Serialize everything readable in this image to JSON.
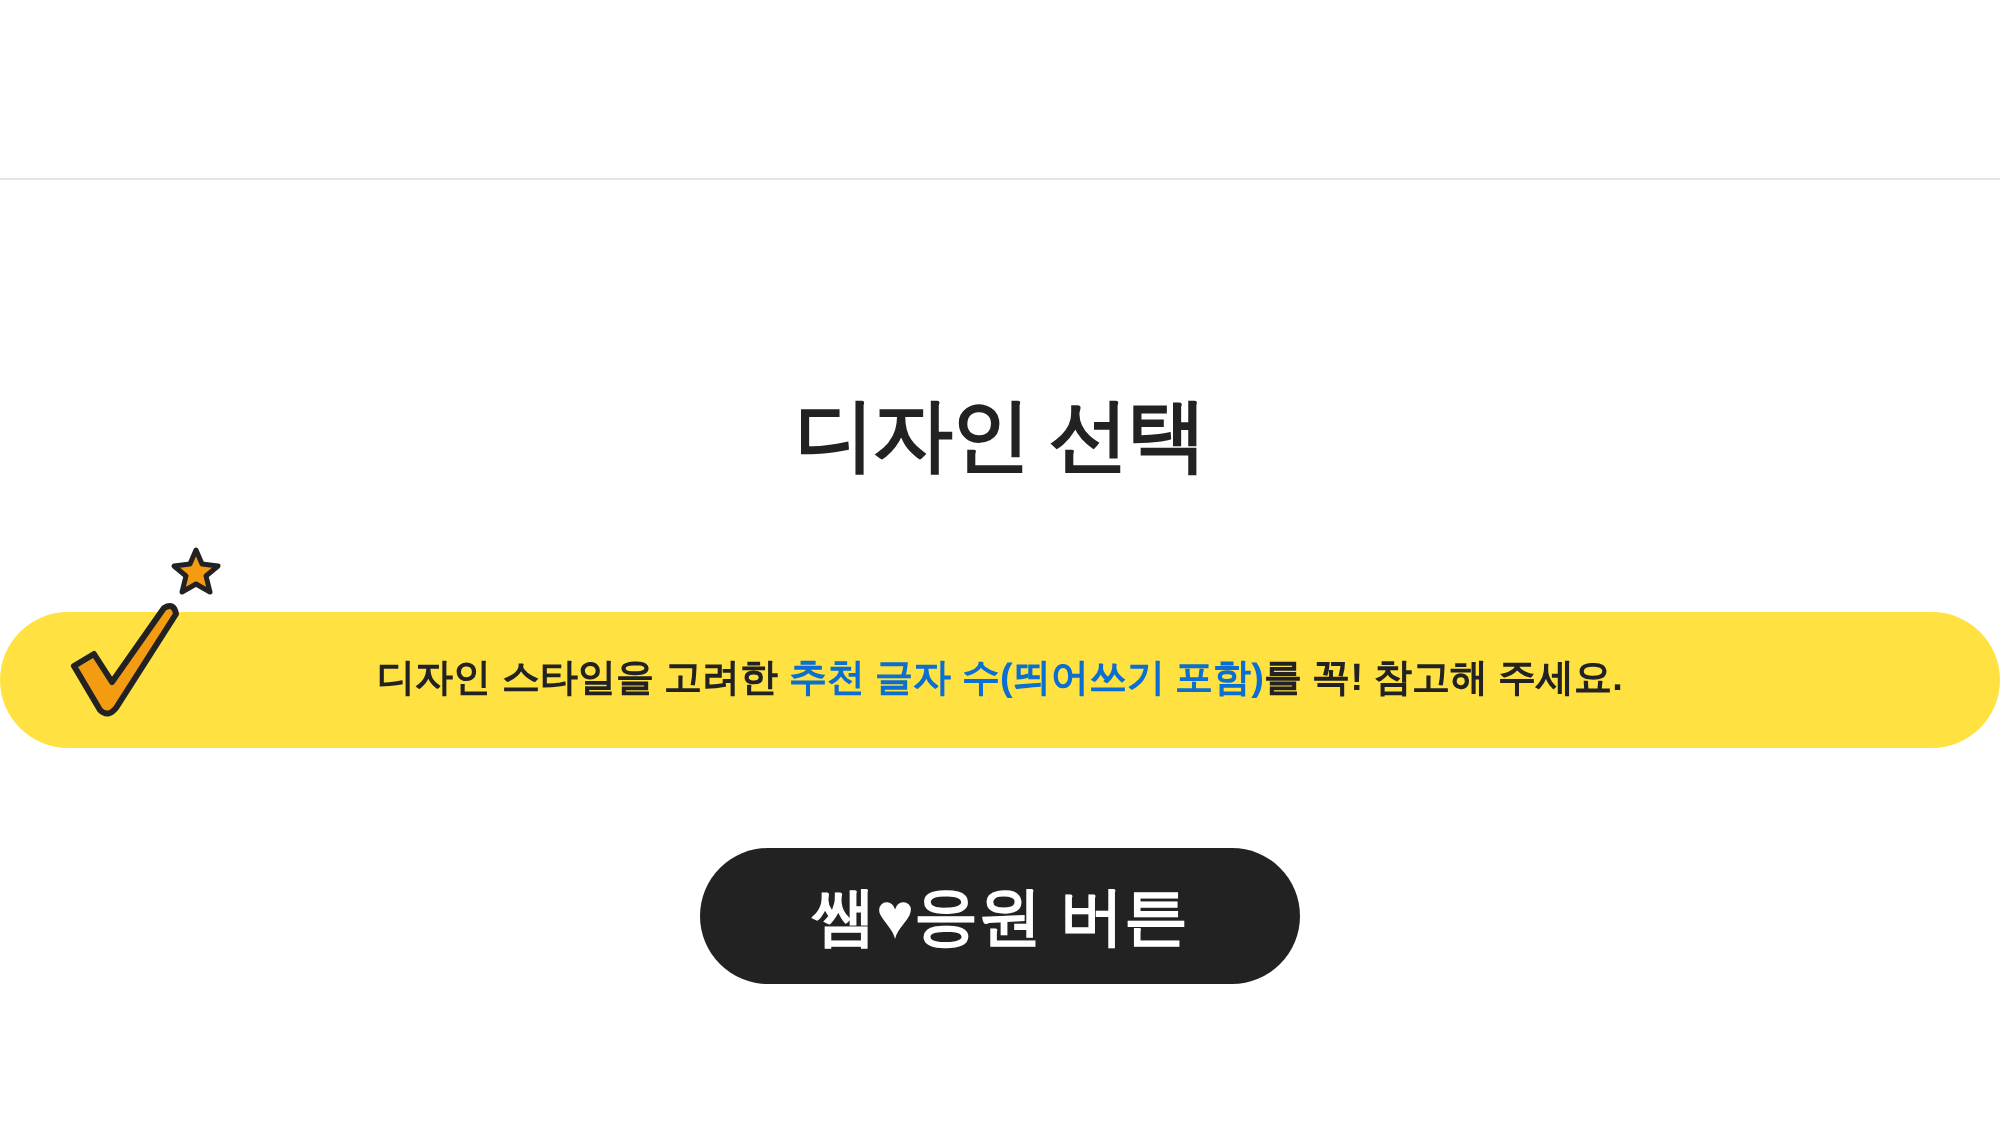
{
  "title": "디자인 선택",
  "notice": {
    "segments": [
      {
        "text": "디자인 스타일을 고려한 ",
        "emphasis": false
      },
      {
        "text": "추천 글자 수(띄어쓰기 포함)",
        "emphasis": true
      },
      {
        "text": "를 꼭! 참고해 주세요.",
        "emphasis": false
      }
    ]
  },
  "button": {
    "label": "쌤♥응원 버튼"
  }
}
